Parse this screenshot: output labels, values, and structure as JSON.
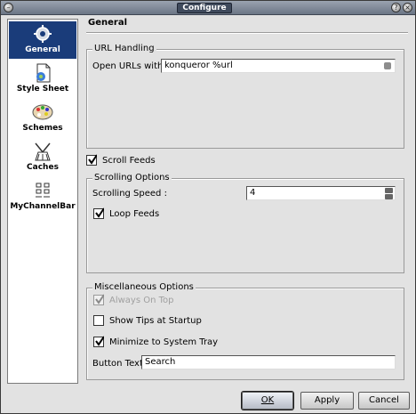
{
  "window": {
    "title": "Configure"
  },
  "sidebar": {
    "items": [
      {
        "label": "General",
        "icon": "gear-icon",
        "active": true
      },
      {
        "label": "Style Sheet",
        "icon": "document-icon",
        "active": false
      },
      {
        "label": "Schemes",
        "icon": "palette-icon",
        "active": false
      },
      {
        "label": "Caches",
        "icon": "broom-icon",
        "active": false
      },
      {
        "label": "MyChannelBar",
        "icon": "grid-icon",
        "active": false
      }
    ]
  },
  "page": {
    "title": "General"
  },
  "url_handling": {
    "title": "URL Handling",
    "open_urls_label": "Open URLs with :",
    "open_urls_value": "konqueror %url"
  },
  "scroll_feeds": {
    "label": "Scroll Feeds",
    "checked": true
  },
  "scrolling_options": {
    "title": "Scrolling Options",
    "speed_label": "Scrolling Speed :",
    "speed_value": "4",
    "loop_label": "Loop Feeds",
    "loop_checked": true
  },
  "misc": {
    "title": "Miscellaneous Options",
    "always_on_top": {
      "label": "Always On Top",
      "checked": true,
      "disabled": true
    },
    "show_tips": {
      "label": "Show Tips at Startup",
      "checked": false
    },
    "minimize_tray": {
      "label": "Minimize to System Tray",
      "checked": true
    },
    "button_text_label": "Button Text :",
    "button_text_value": "Search"
  },
  "buttons": {
    "ok": "OK",
    "apply": "Apply",
    "cancel": "Cancel"
  },
  "colors": {
    "sidebar_active": "#1a3c7a",
    "dialog_bg": "#e2e2e2"
  }
}
